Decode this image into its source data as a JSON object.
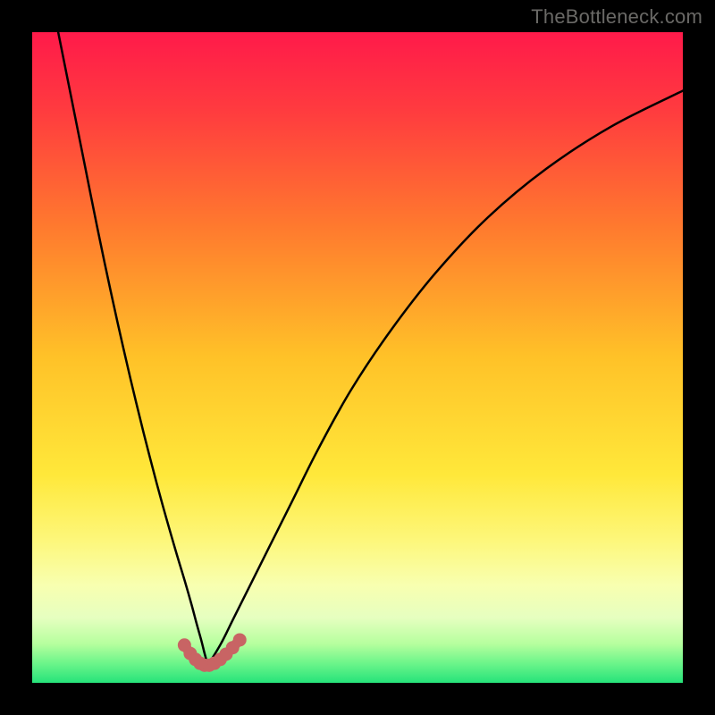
{
  "watermark": "TheBottleneck.com",
  "colors": {
    "frame": "#000000",
    "curves": "#000000",
    "marker_stroke": "#c86464",
    "marker_fill_alpha": 0.0
  },
  "chart_data": {
    "type": "line",
    "title": "",
    "xlabel": "",
    "ylabel": "",
    "xlim": [
      0,
      100
    ],
    "ylim": [
      0,
      100
    ],
    "x_min_at": 27,
    "gradient_stops": [
      {
        "pct": 0,
        "color": "#ff1a4a"
      },
      {
        "pct": 12,
        "color": "#ff3b3f"
      },
      {
        "pct": 30,
        "color": "#ff7a2e"
      },
      {
        "pct": 50,
        "color": "#ffc228"
      },
      {
        "pct": 68,
        "color": "#ffe83a"
      },
      {
        "pct": 78,
        "color": "#fdf77a"
      },
      {
        "pct": 85,
        "color": "#f8ffb0"
      },
      {
        "pct": 90,
        "color": "#e6ffc0"
      },
      {
        "pct": 94,
        "color": "#b6ff9e"
      },
      {
        "pct": 97,
        "color": "#6cf58a"
      },
      {
        "pct": 100,
        "color": "#26e37a"
      }
    ],
    "series": [
      {
        "name": "left-curve",
        "x": [
          4,
          6,
          8,
          10,
          12,
          14,
          16,
          18,
          20,
          22,
          23.5,
          24.5,
          25.3,
          26,
          26.5,
          27
        ],
        "y": [
          100,
          90,
          80,
          70,
          60.5,
          51.5,
          43,
          35,
          27.5,
          20.5,
          15.5,
          12,
          9,
          6.5,
          4.5,
          2.7
        ]
      },
      {
        "name": "right-curve",
        "x": [
          27,
          29,
          31,
          33.5,
          36.5,
          40,
          44,
          49,
          55,
          62,
          70,
          79,
          89,
          100
        ],
        "y": [
          2.7,
          6,
          10,
          15,
          21,
          28,
          36,
          45,
          54,
          63,
          71.5,
          79,
          85.5,
          91
        ]
      },
      {
        "name": "bottom-markers",
        "type": "scatter-line",
        "x": [
          23.4,
          24.3,
          25.1,
          25.8,
          26.5,
          27.2,
          28.0,
          28.9,
          29.8,
          30.8,
          31.9
        ],
        "y": [
          5.8,
          4.5,
          3.6,
          3.0,
          2.7,
          2.7,
          3.0,
          3.6,
          4.4,
          5.4,
          6.6
        ]
      }
    ]
  }
}
